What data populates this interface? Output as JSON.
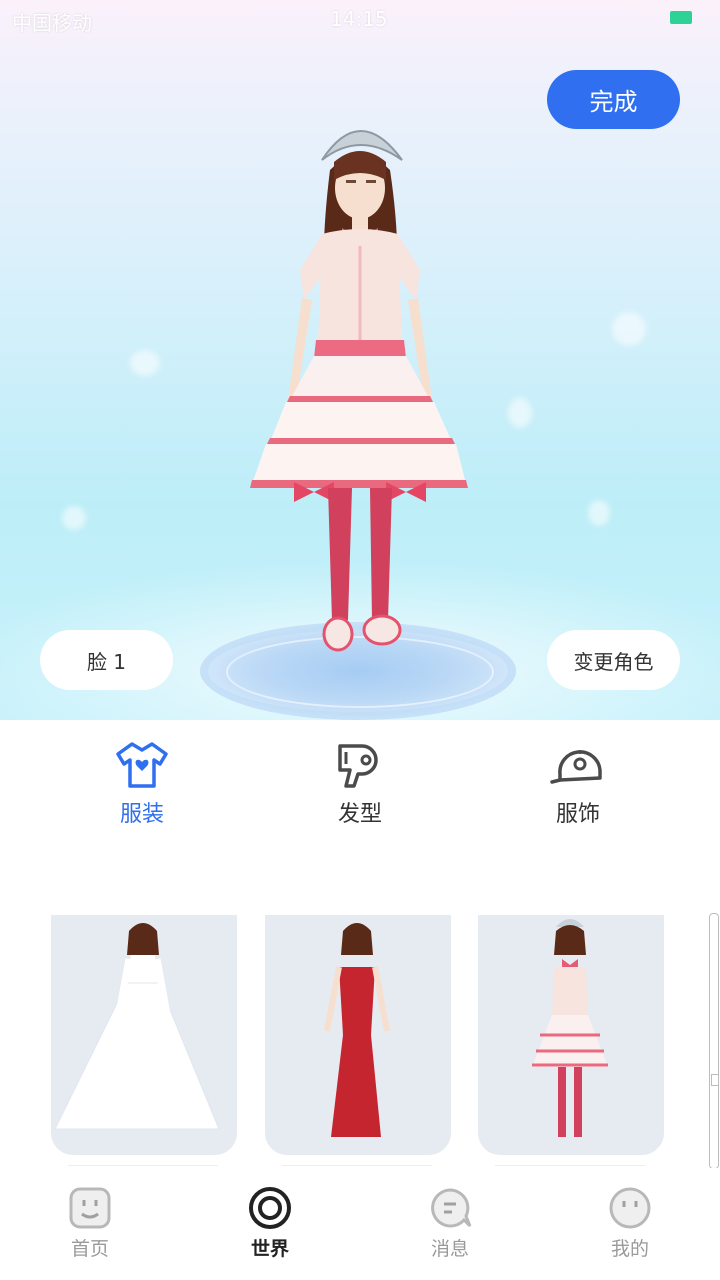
{
  "status_bar": {
    "carrier": "中国移动",
    "time": "14:15"
  },
  "editor": {
    "done_label": "完成",
    "face_label": "脸 1",
    "change_role_label": "变更角色"
  },
  "tabs": [
    {
      "label": "服装",
      "icon": "tshirt-icon",
      "active": true
    },
    {
      "label": "发型",
      "icon": "hair-dryer-icon",
      "active": false
    },
    {
      "label": "服饰",
      "icon": "cap-icon",
      "active": false
    }
  ],
  "outfits": [
    {
      "icon": "white-wedding-dress-icon"
    },
    {
      "icon": "red-evening-gown-icon"
    },
    {
      "icon": "pink-lolita-dress-icon"
    }
  ],
  "bottom_nav": [
    {
      "label": "首页",
      "icon": "home-face-icon",
      "active": false
    },
    {
      "label": "世界",
      "icon": "world-ring-icon",
      "active": true
    },
    {
      "label": "消息",
      "icon": "message-bubble-icon",
      "active": false
    },
    {
      "label": "我的",
      "icon": "profile-face-icon",
      "active": false
    }
  ],
  "colors": {
    "accent": "#2f6ff0",
    "inactive_nav": "#9a9a9a",
    "card_bg": "#e6eaf1",
    "battery": "#2ed196"
  }
}
